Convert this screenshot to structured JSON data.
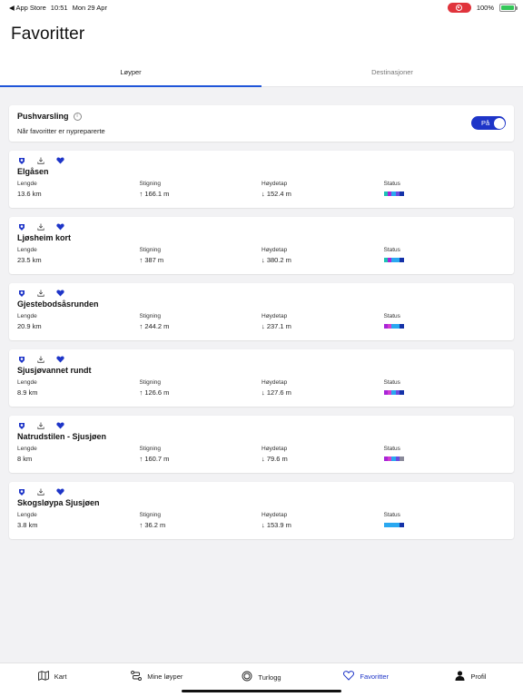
{
  "status_bar": {
    "back_app": "◀ App Store",
    "time": "10:51",
    "date": "Mon 29 Apr",
    "battery": "100%"
  },
  "page": {
    "title": "Favoritter"
  },
  "tabs": [
    {
      "label": "Løyper",
      "active": true
    },
    {
      "label": "Destinasjoner",
      "active": false
    }
  ],
  "push": {
    "title": "Pushvarsling",
    "subtitle": "Når favoritter er nypreparerte",
    "toggle_label": "På",
    "enabled": true
  },
  "labels": {
    "length": "Lengde",
    "climb": "Stigning",
    "descent": "Høydetap",
    "status": "Status"
  },
  "trails": [
    {
      "name": "Elgåsen",
      "length": "13.6 km",
      "climb": "↑ 166.1 m",
      "descent": "↓ 152.4 m",
      "status_colors": [
        "#1cc3b5",
        "#a825d8",
        "#2aa8f0",
        "#6a4ce0",
        "#1432a8"
      ]
    },
    {
      "name": "Ljøsheim kort",
      "length": "23.5 km",
      "climb": "↑ 387 m",
      "descent": "↓ 380.2 m",
      "status_colors": [
        "#1cc3b5",
        "#a825d8",
        "#2aa8f0",
        "#2aa8f0",
        "#1432a8"
      ]
    },
    {
      "name": "Gjestebodsåsrunden",
      "length": "20.9 km",
      "climb": "↑ 244.2 m",
      "descent": "↓ 237.1 m",
      "status_colors": [
        "#a825d8",
        "#d23cd0",
        "#2aa8f0",
        "#2aa8f0",
        "#1432a8"
      ]
    },
    {
      "name": "Sjusjøvannet rundt",
      "length": "8.9 km",
      "climb": "↑ 126.6 m",
      "descent": "↓ 127.6 m",
      "status_colors": [
        "#a825d8",
        "#d23cd0",
        "#2aa8f0",
        "#6a4ce0",
        "#1432a8"
      ]
    },
    {
      "name": "Natrudstilen - Sjusjøen",
      "length": "8 km",
      "climb": "↑ 160.7 m",
      "descent": "↓ 79.6 m",
      "status_colors": [
        "#a825d8",
        "#d23cd0",
        "#2aa8f0",
        "#6a4ce0",
        "#8a8a9a"
      ]
    },
    {
      "name": "Skogsløypa Sjusjøen",
      "length": "3.8 km",
      "climb": "↑ 36.2 m",
      "descent": "↓ 153.9 m",
      "status_colors": [
        "#2aa8f0",
        "#2aa8f0",
        "#2aa8f0",
        "#2aa8f0",
        "#1432a8"
      ]
    }
  ],
  "icons": {
    "trail_row": [
      "badge-icon",
      "download-icon",
      "heart-icon"
    ]
  },
  "colors": {
    "accent": "#1e35c8",
    "background": "#f2f2f4"
  },
  "nav": [
    {
      "label": "Kart",
      "icon": "map-icon",
      "active": false
    },
    {
      "label": "Mine løyper",
      "icon": "route-icon",
      "active": false
    },
    {
      "label": "Turlogg",
      "icon": "log-icon",
      "active": false
    },
    {
      "label": "Favoritter",
      "icon": "heart-icon",
      "active": true
    },
    {
      "label": "Profil",
      "icon": "person-icon",
      "active": false
    }
  ]
}
